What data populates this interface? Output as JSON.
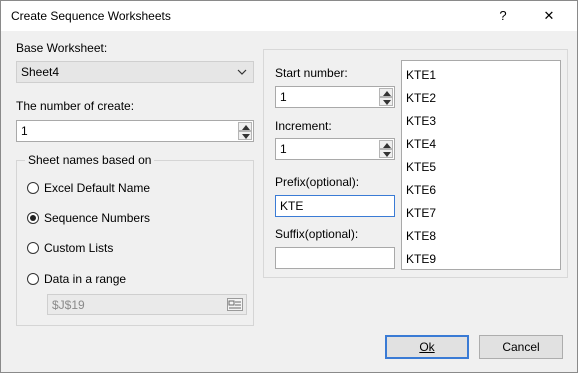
{
  "window": {
    "title": "Create Sequence Worksheets",
    "help_glyph": "?",
    "close_glyph": "✕"
  },
  "base_worksheet": {
    "label": "Base Worksheet:",
    "selected": "Sheet4"
  },
  "number_of_create": {
    "label": "The number of create:",
    "value": "1"
  },
  "sheet_names_group": {
    "title": "Sheet names based on",
    "options": [
      {
        "label": "Excel Default Name",
        "selected": false
      },
      {
        "label": "Sequence Numbers",
        "selected": true
      },
      {
        "label": "Custom Lists",
        "selected": false
      },
      {
        "label": "Data in a range",
        "selected": false
      }
    ],
    "range_value": "$J$19"
  },
  "sequence": {
    "start_label": "Start number:",
    "start_value": "1",
    "increment_label": "Increment:",
    "increment_value": "1",
    "prefix_label": "Prefix(optional):",
    "prefix_value": "KTE",
    "suffix_label": "Suffix(optional):",
    "suffix_value": ""
  },
  "preview_list": [
    "KTE1",
    "KTE2",
    "KTE3",
    "KTE4",
    "KTE5",
    "KTE6",
    "KTE7",
    "KTE8",
    "KTE9"
  ],
  "buttons": {
    "ok": "Ok",
    "cancel": "Cancel"
  },
  "colors": {
    "dialog_bg": "#f0f0f0",
    "default_button_border": "#3a7bd5"
  }
}
